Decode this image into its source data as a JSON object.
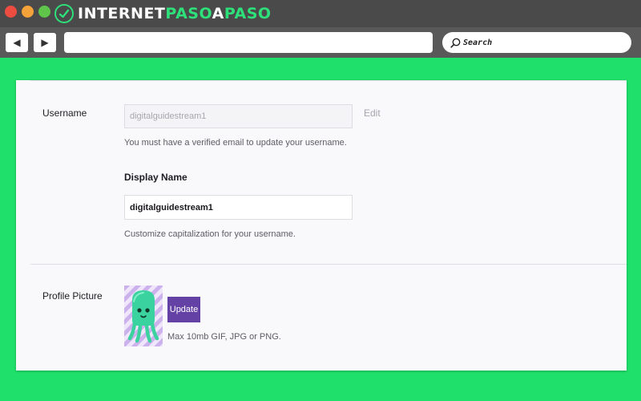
{
  "brand": {
    "part1": "INTERNET",
    "part2": "PASO",
    "part3": "A",
    "part4": "PASO"
  },
  "browser": {
    "back_glyph": "◀",
    "forward_glyph": "▶",
    "search_placeholder": "Search"
  },
  "settings": {
    "username": {
      "label": "Username",
      "value": "digitalguidestream1",
      "edit_label": "Edit",
      "help": "You must have a verified email to update your username."
    },
    "display_name": {
      "label": "Display Name",
      "value": "digitalguidestream1",
      "help": "Customize capitalization for your username."
    },
    "profile_picture": {
      "label": "Profile Picture",
      "update_label": "Update",
      "help": "Max 10mb GIF, JPG or PNG."
    }
  },
  "colors": {
    "page_bg": "#1fe06a",
    "brand_green": "#2ee07a",
    "update_button": "#6441a4",
    "avatar_body": "#3ad3a0"
  }
}
